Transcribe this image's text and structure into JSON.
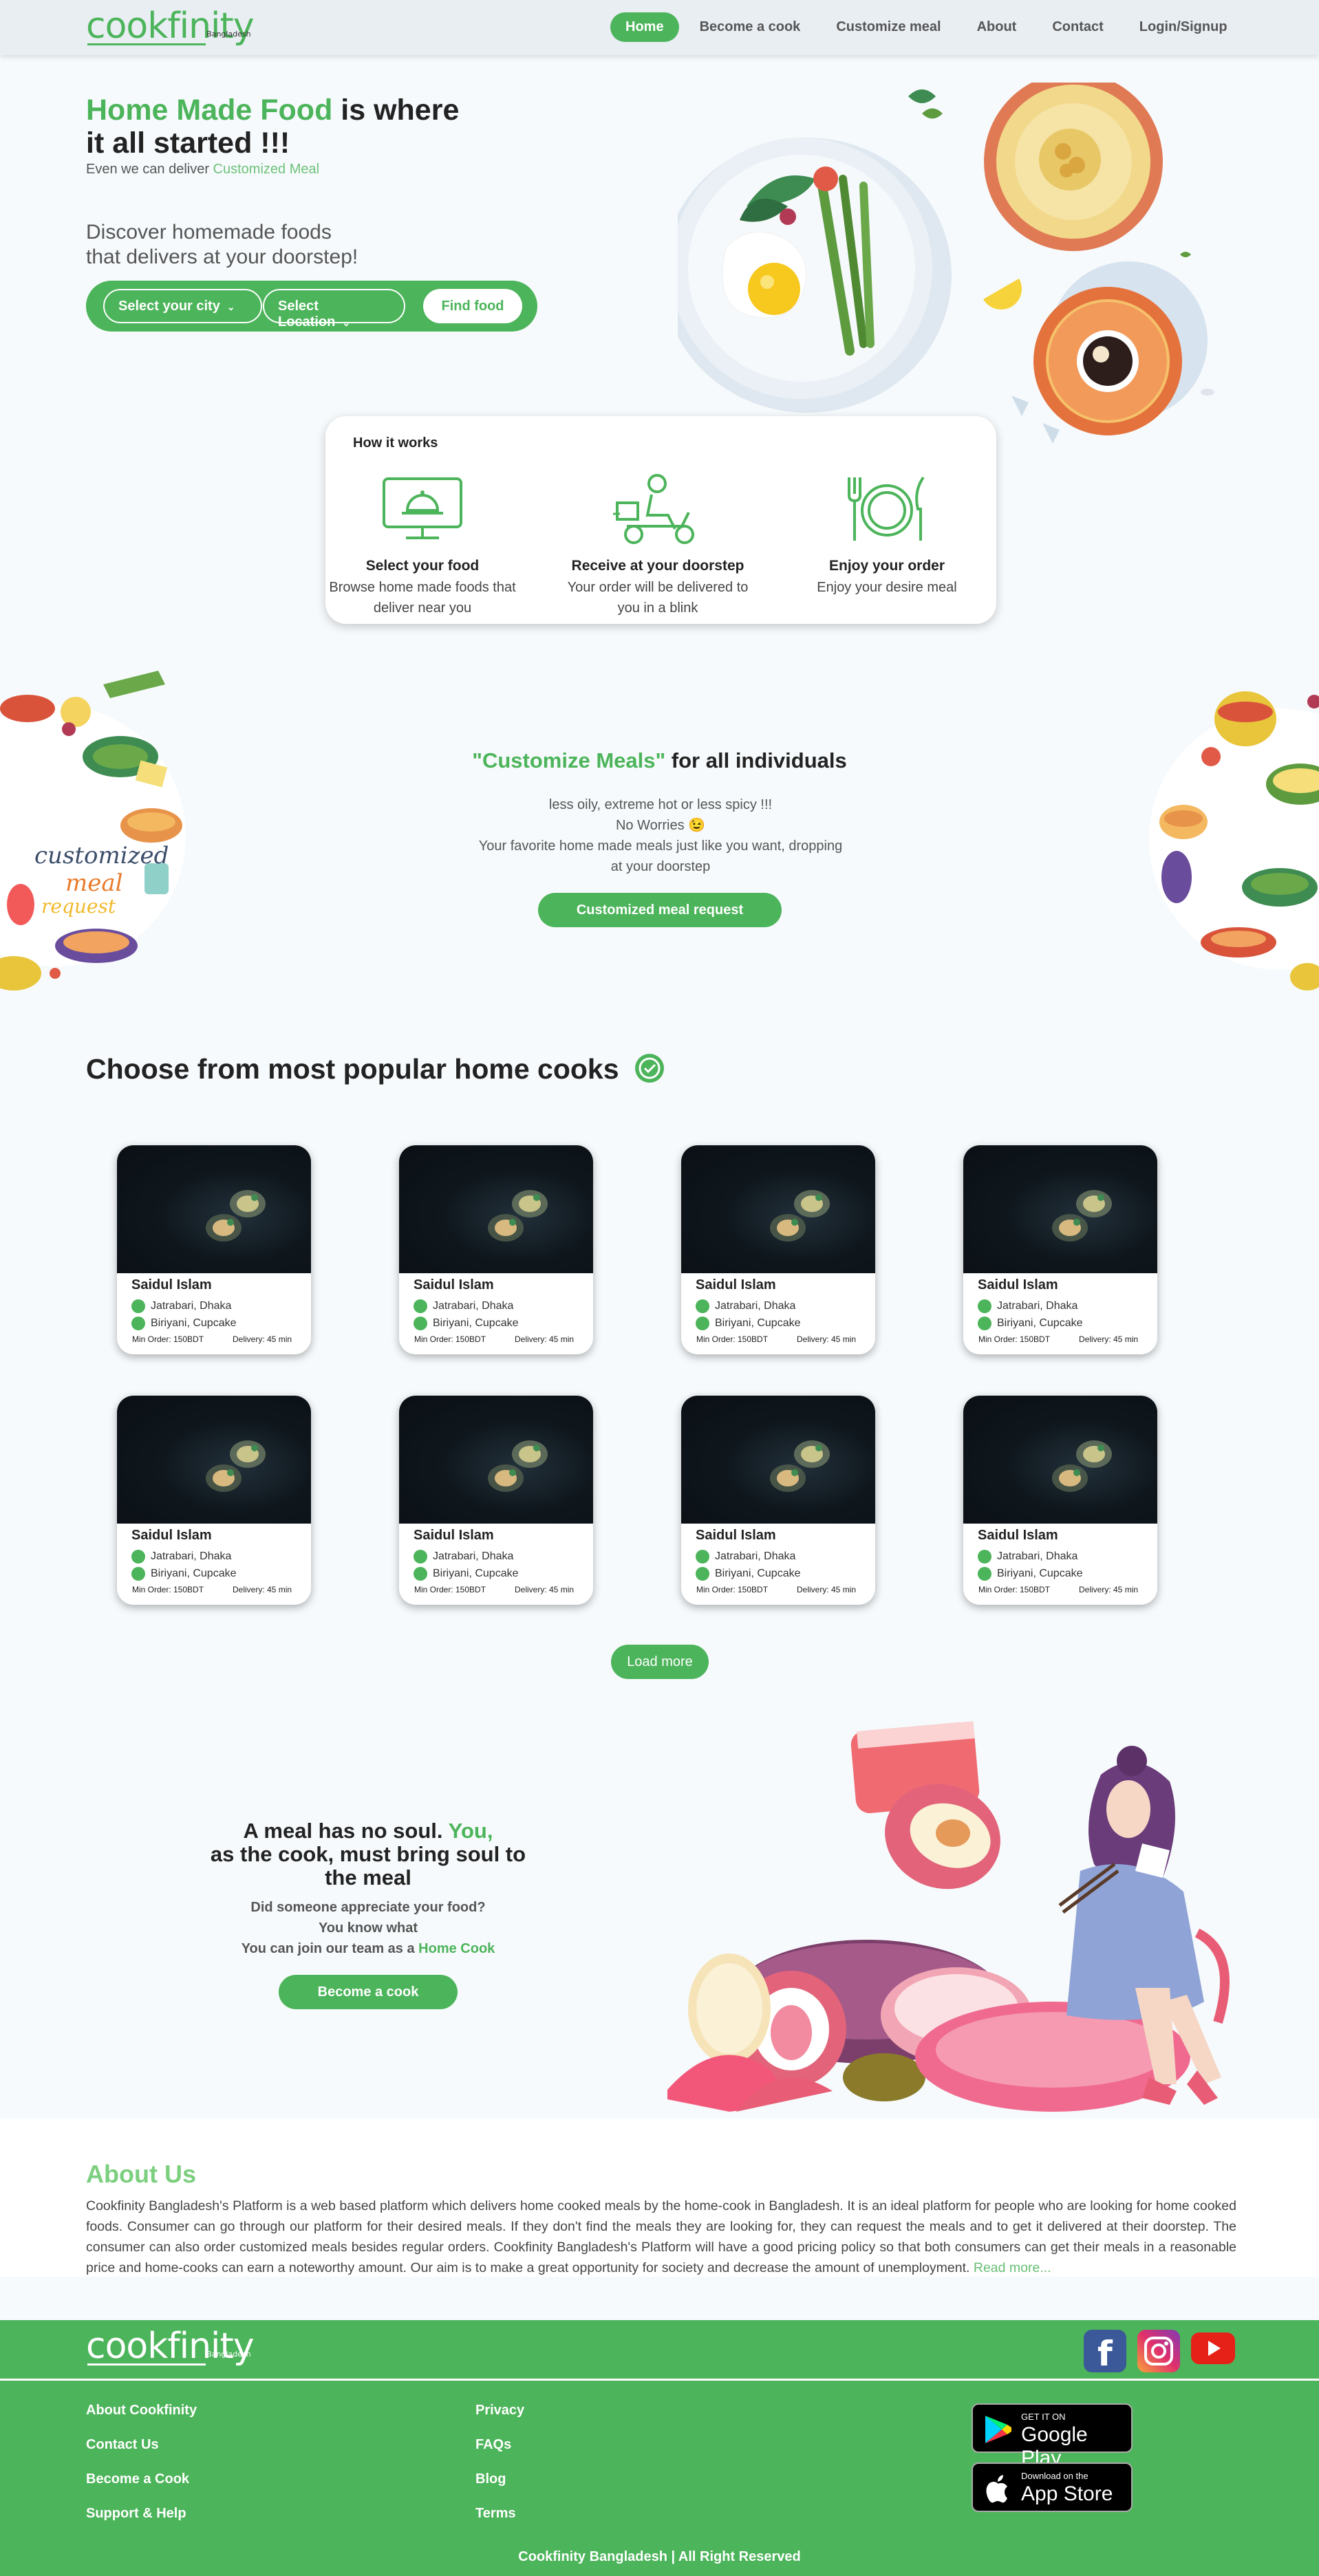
{
  "nav": {
    "logo": "cookfinity",
    "logo_sub": "Bangladesh",
    "links": [
      "Home",
      "Become a cook",
      "Customize meal",
      "About",
      "Contact",
      "Login/Signup"
    ]
  },
  "hero": {
    "title_green": "Home Made Food",
    "title_rest_1": " is where",
    "title_rest_2": "it all started !!!",
    "sub_prefix": "Even we can deliver ",
    "sub_link": "Customized Meal",
    "discover_1": "Discover homemade foods",
    "discover_2": "that delivers at your doorstep!",
    "city_select": "Select your city",
    "location_select": "Select Location",
    "find_button": "Find food"
  },
  "how": {
    "title": "How it works",
    "steps": [
      {
        "title": "Select your food",
        "desc": "Browse home made foods that deliver near you"
      },
      {
        "title": "Receive at your doorstep",
        "desc": "Your order will be delivered to you in a blink"
      },
      {
        "title": "Enjoy your order",
        "desc": "Enjoy your desire meal"
      }
    ]
  },
  "customize": {
    "title_green": "\"Customize Meals\"",
    "title_rest": " for all individuals",
    "line1": "less oily, extreme hot or less spicy !!!",
    "line2": "No Worries 😉",
    "line3": "Your favorite home made meals just like you want, dropping at your doorstep",
    "button": "Customized meal request",
    "art_text_1": "customized",
    "art_text_2": "meal",
    "art_text_3": "request"
  },
  "cooks": {
    "title": "Choose from most popular home cooks",
    "cards": [
      {
        "name": "Saidul Islam",
        "location": "Jatrabari, Dhaka",
        "foods": "Biriyani, Cupcake",
        "min_order": "Min Order: 150BDT",
        "delivery": "Delivery: 45 min"
      },
      {
        "name": "Saidul Islam",
        "location": "Jatrabari, Dhaka",
        "foods": "Biriyani, Cupcake",
        "min_order": "Min Order: 150BDT",
        "delivery": "Delivery: 45 min"
      },
      {
        "name": "Saidul Islam",
        "location": "Jatrabari, Dhaka",
        "foods": "Biriyani, Cupcake",
        "min_order": "Min Order: 150BDT",
        "delivery": "Delivery: 45 min"
      },
      {
        "name": "Saidul Islam",
        "location": "Jatrabari, Dhaka",
        "foods": "Biriyani, Cupcake",
        "min_order": "Min Order: 150BDT",
        "delivery": "Delivery: 45 min"
      },
      {
        "name": "Saidul Islam",
        "location": "Jatrabari, Dhaka",
        "foods": "Biriyani, Cupcake",
        "min_order": "Min Order: 150BDT",
        "delivery": "Delivery: 45 min"
      },
      {
        "name": "Saidul Islam",
        "location": "Jatrabari, Dhaka",
        "foods": "Biriyani, Cupcake",
        "min_order": "Min Order: 150BDT",
        "delivery": "Delivery: 45 min"
      },
      {
        "name": "Saidul Islam",
        "location": "Jatrabari, Dhaka",
        "foods": "Biriyani, Cupcake",
        "min_order": "Min Order: 150BDT",
        "delivery": "Delivery: 45 min"
      },
      {
        "name": "Saidul Islam",
        "location": "Jatrabari, Dhaka",
        "foods": "Biriyani, Cupcake",
        "min_order": "Min Order: 150BDT",
        "delivery": "Delivery: 45 min"
      }
    ],
    "load_more": "Load more"
  },
  "soul": {
    "title_1": "A meal has no soul. ",
    "title_green": "You,",
    "title_2": "as the cook, must bring soul to the meal",
    "line1": "Did someone appreciate your food?",
    "line2": "You know what",
    "line3_prefix": "You can join our team as a ",
    "line3_green": "Home Cook",
    "button": "Become a cook"
  },
  "about": {
    "title": "About Us",
    "text": "Cookfinity Bangladesh's Platform is a web based platform which delivers home cooked meals by the home-cook in Bangladesh. It is an ideal platform for people who are looking for home cooked foods. Consumer can go through our platform for their desired meals. If they don't find the meals they are looking for, they can request the meals and to get it delivered at their doorstep. The consumer can also order customized meals besides regular orders. Cookfinity Bangladesh's Platform will have a good pricing policy so that both consumers can get their meals in a reasonable price and home-cooks can earn a noteworthy amount. Our aim is to make a great opportunity for society and decrease the amount of unemployment. ",
    "read_more": "Read more..."
  },
  "footer": {
    "logo": "cookfinity",
    "logo_sub": "Bangladesh",
    "col1": [
      "About Cookfinity",
      "Contact Us",
      "Become a Cook",
      "Support & Help"
    ],
    "col2": [
      "Privacy",
      "FAQs",
      "Blog",
      "Terms"
    ],
    "google_small": "GET IT ON",
    "google_big": "Google Play",
    "apple_small": "Download on the",
    "apple_big": "App Store",
    "copyright": "Cookfinity Bangladesh | All Right Reserved"
  },
  "colors": {
    "brand": "#4cb45a",
    "facebook": "#3b5998",
    "youtube": "#e62117"
  }
}
